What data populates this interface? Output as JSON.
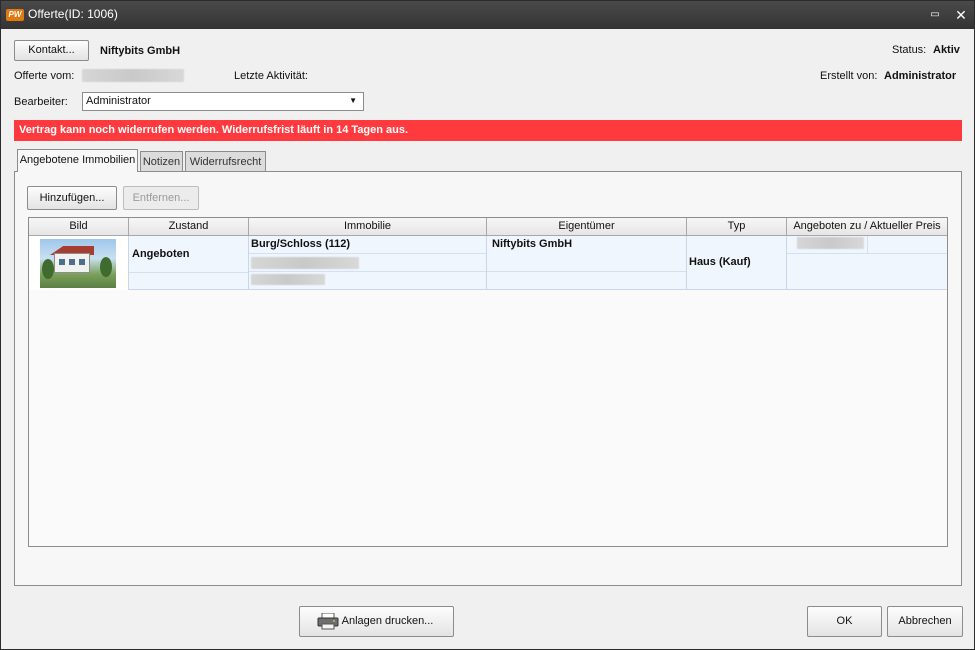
{
  "window": {
    "title": "Offerte(ID: 1006)",
    "app_icon": "PW",
    "minimize_glyph": "▭",
    "close_glyph": "✕"
  },
  "header": {
    "contact_button": "Kontakt...",
    "contact_name": "Niftybits GmbH",
    "status_label": "Status:",
    "status_value": "Aktiv",
    "offer_date_label": "Offerte vom:",
    "last_activity_label": "Letzte Aktivität:",
    "created_by_label": "Erstellt von:",
    "created_by_value": "Administrator",
    "editor_label": "Bearbeiter:",
    "editor_value": "Administrator"
  },
  "banner": {
    "text": "Vertrag kann noch widerrufen werden. Widerrufsfrist läuft in 14 Tagen aus.",
    "color": "#fe3a3f"
  },
  "tabs": [
    {
      "label": "Angebotene Immobilien",
      "active": true
    },
    {
      "label": "Notizen",
      "active": false
    },
    {
      "label": "Widerrufsrecht",
      "active": false
    }
  ],
  "toolbar": {
    "add_button": "Hinzufügen...",
    "remove_button": "Entfernen..."
  },
  "grid": {
    "columns": [
      "Bild",
      "Zustand",
      "Immobilie",
      "Eigentümer",
      "Typ",
      "Angeboten zu / Aktueller Preis"
    ],
    "rows": [
      {
        "zustand": "Angeboten",
        "immobilie": "Burg/Schloss (112)",
        "eigentuemer": "Niftybits GmbH",
        "typ": "Haus (Kauf)"
      }
    ]
  },
  "footer": {
    "print_button": "Anlagen drucken...",
    "print_icon": "printer-icon",
    "ok_button": "OK",
    "cancel_button": "Abbrechen"
  }
}
